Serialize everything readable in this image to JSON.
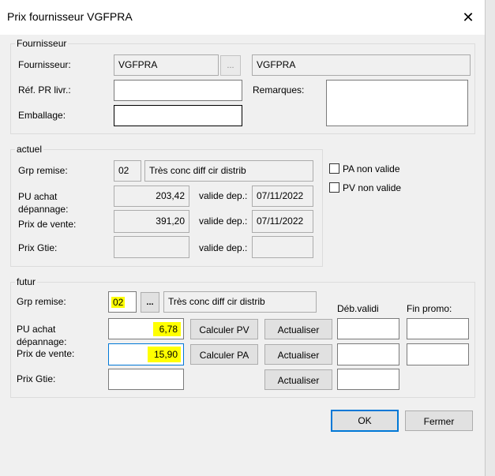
{
  "window": {
    "title": "Prix fournisseur VGFPRA",
    "close_glyph": "✕"
  },
  "fournisseur": {
    "legend": "Fournisseur",
    "fournisseur_label": "Fournisseur:",
    "fournisseur_code": "VGFPRA",
    "fournisseur_name": "VGFPRA",
    "browse_label": "...",
    "ref_label": "Réf. PR livr.:",
    "ref_value": "",
    "remarques_label": "Remarques:",
    "remarques_value": "",
    "emballage_label": "Emballage:",
    "emballage_value": ""
  },
  "actuel": {
    "legend": "actuel",
    "grp_label": "Grp remise:",
    "grp_code": "02",
    "grp_desc": "Très conc diff cir distrib",
    "pu_label": "PU achat dépannage:",
    "pu_value": "203,42",
    "pu_valide_label": "valide dep.:",
    "pu_valide_date": "07/11/2022",
    "pv_label": "Prix de vente:",
    "pv_value": "391,20",
    "pv_valide_label": "valide dep.:",
    "pv_valide_date": "07/11/2022",
    "gtie_label": "Prix Gtie:",
    "gtie_value": "",
    "gtie_valide_label": "valide dep.:",
    "gtie_valide_date": "",
    "pa_non_valide_label": "PA non valide",
    "pv_non_valide_label": "PV non valide"
  },
  "futur": {
    "legend": "futur",
    "grp_label": "Grp remise:",
    "grp_code": "02",
    "browse_label": "...",
    "grp_desc": "Très conc diff cir distrib",
    "deb_validite_header": "Déb.validi",
    "fin_promo_header": "Fin promo:",
    "pu_label": "PU achat dépannage:",
    "pu_value": "6,78",
    "calc_pv_label": "Calculer PV",
    "actualiser1_label": "Actualiser",
    "pv_label": "Prix de vente:",
    "pv_value": "15,90",
    "calc_pa_label": "Calculer PA",
    "actualiser2_label": "Actualiser",
    "gtie_label": "Prix Gtie:",
    "gtie_value": "",
    "actualiser3_label": "Actualiser"
  },
  "footer": {
    "ok_label": "OK",
    "fermer_label": "Fermer"
  },
  "colors": {
    "highlight": "#ffff00",
    "focus_border": "#0078d7",
    "dialog_bg": "#f0f0f0"
  }
}
